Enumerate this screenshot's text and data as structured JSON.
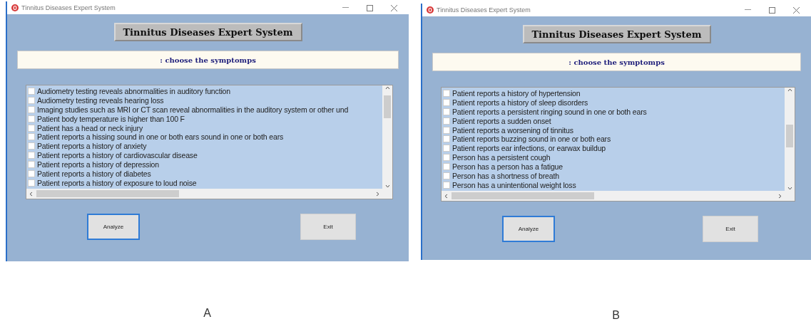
{
  "panels": [
    {
      "window": {
        "title": "Tinnitus Diseases Expert System"
      },
      "header": "Tinnitus Diseases Expert System",
      "prompt": ": choose the symptomps",
      "symptoms": [
        {
          "label": "Audiometry testing reveals abnormalities in auditory function",
          "checked": false
        },
        {
          "label": "Audiometry testing reveals hearing loss",
          "checked": false
        },
        {
          "label": "Imaging studies such as MRI or CT scan reveal abnormalities in the auditory system or other und",
          "checked": false
        },
        {
          "label": "Patient body temperature is higher than 100 F",
          "checked": false
        },
        {
          "label": "Patient has a head or neck injury",
          "checked": false
        },
        {
          "label": "Patient reports a hissing sound in one or both ears sound in one or both ears",
          "checked": false
        },
        {
          "label": "Patient reports a history of anxiety",
          "checked": false
        },
        {
          "label": "Patient reports a history of cardiovascular disease",
          "checked": false
        },
        {
          "label": "Patient reports a history of depression",
          "checked": false
        },
        {
          "label": "Patient reports a history of diabetes",
          "checked": false
        },
        {
          "label": "Patient reports a history of exposure to loud noise",
          "checked": false
        }
      ],
      "buttons": [
        {
          "label": "Analyze",
          "focused": true
        },
        {
          "label": "Exit",
          "focused": false
        }
      ],
      "caption": "A"
    },
    {
      "window": {
        "title": "Tinnitus Diseases Expert System"
      },
      "header": "Tinnitus Diseases Expert System",
      "prompt": ": choose the symptomps",
      "symptoms": [
        {
          "label": "Patient reports a history of hypertension",
          "checked": false
        },
        {
          "label": "Patient reports a history of sleep disorders",
          "checked": false
        },
        {
          "label": "Patient reports a persistent ringing sound in one or both ears",
          "checked": false
        },
        {
          "label": "Patient reports a sudden onset",
          "checked": false
        },
        {
          "label": "Patient reports a worsening of tinnitus",
          "checked": false
        },
        {
          "label": "Patient reports buzzing sound in one or both ears",
          "checked": false
        },
        {
          "label": "Patient reports ear infections, or earwax buildup",
          "checked": false
        },
        {
          "label": "Person has a persistent cough",
          "checked": false
        },
        {
          "label": "Person has a person has a fatigue",
          "checked": false
        },
        {
          "label": "Person has a shortness of breath",
          "checked": false
        },
        {
          "label": "Person has a unintentional weight loss",
          "checked": false
        }
      ],
      "buttons": [
        {
          "label": "Analyze",
          "focused": true
        },
        {
          "label": "Exit",
          "focused": false
        }
      ],
      "caption": "B"
    }
  ]
}
